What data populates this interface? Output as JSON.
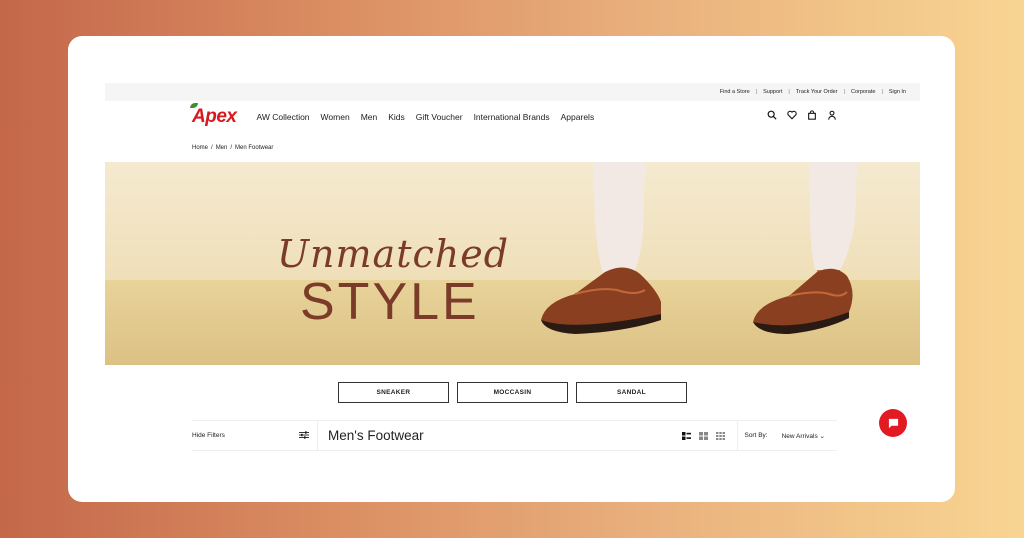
{
  "topbar": {
    "links": [
      "Find a Store",
      "Support",
      "Track Your Order",
      "Corporate",
      "Sign In"
    ]
  },
  "brand": {
    "logo": "Apex",
    "accent_color": "#d71920"
  },
  "nav": {
    "items": [
      "AW Collection",
      "Women",
      "Men",
      "Kids",
      "Gift Voucher",
      "International Brands",
      "Apparels"
    ],
    "icons": [
      "search-icon",
      "heart-icon",
      "bag-icon",
      "user-icon"
    ]
  },
  "breadcrumb": {
    "items": [
      "Home",
      "Men",
      "Men Footwear"
    ]
  },
  "banner": {
    "line1": "Unmatched",
    "line2": "STYLE"
  },
  "categories": [
    "SNEAKER",
    "MOCCASIN",
    "SANDAL"
  ],
  "listing": {
    "hide_filters": "Hide Filters",
    "title": "Men's Footwear",
    "sort_label": "Sort By:",
    "sort_value": "New Arrivals"
  },
  "chat": {
    "icon": "chat-icon",
    "color": "#e21b23"
  }
}
